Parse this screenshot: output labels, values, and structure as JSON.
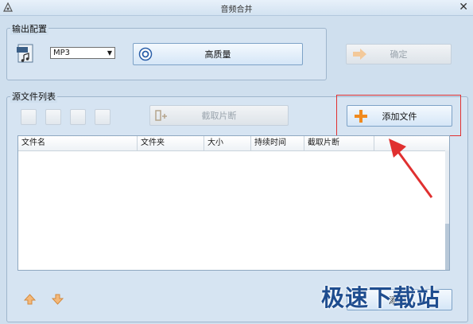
{
  "window": {
    "title": "音频合并"
  },
  "output_settings": {
    "title": "输出配置",
    "format_selected": "MP3",
    "quality_button": "高质量",
    "confirm_button": "确定"
  },
  "source_list": {
    "title": "源文件列表",
    "clip_button": "截取片断",
    "add_file_button": "添加文件",
    "columns": [
      "文件名",
      "文件夹",
      "大小",
      "持续时间",
      "截取片断"
    ],
    "bottom_button": "添加"
  },
  "watermark": "极速下载站",
  "colors": {
    "accent": "#f08a1e",
    "annotation": "#e03030",
    "window_bg": "#cfdfee"
  },
  "icons": [
    "app-icon",
    "mp3-file-icon",
    "quality-gear-icon",
    "arrow-right-icon",
    "plus-icon",
    "close-icon",
    "move-up-icon",
    "move-down-icon"
  ]
}
